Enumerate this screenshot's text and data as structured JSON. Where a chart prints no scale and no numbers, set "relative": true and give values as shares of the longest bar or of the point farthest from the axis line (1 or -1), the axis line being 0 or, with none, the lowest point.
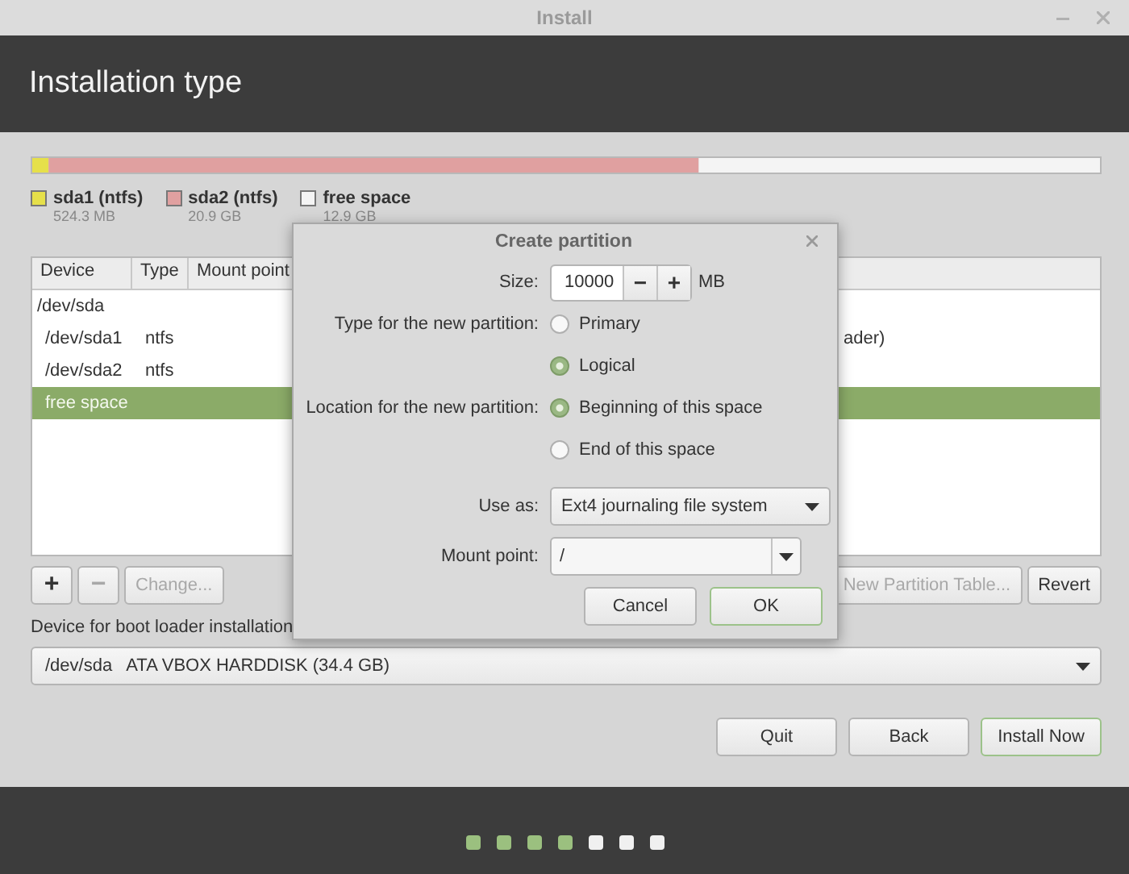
{
  "window": {
    "title": "Install"
  },
  "header": {
    "title": "Installation type"
  },
  "partition_bar": {
    "chart_data": {
      "type": "bar",
      "orientation": "horizontal",
      "stacked": true,
      "relative": true,
      "legend": "below",
      "value_labels": [
        "524.3 MB",
        "20.9 GB",
        "12.9 GB"
      ],
      "series": [
        {
          "name": "sda1 (ntfs)",
          "color": "#e6e04a",
          "values": [
            0.0153
          ]
        },
        {
          "name": "sda2 (ntfs)",
          "color": "#e0a0a0",
          "values": [
            0.6089
          ]
        },
        {
          "name": "free space",
          "color": "#f4f4f4",
          "values": [
            0.3758
          ]
        }
      ]
    }
  },
  "table": {
    "columns": [
      "Device",
      "Type",
      "Mount point"
    ],
    "rows": [
      {
        "device": "/dev/sda",
        "selected": false,
        "children": [
          {
            "device": "/dev/sda1",
            "type": "ntfs",
            "column_4": "ader)",
            "selected": false
          },
          {
            "device": "/dev/sda2",
            "type": "ntfs",
            "selected": false
          },
          {
            "device": "free space",
            "selected": true
          }
        ]
      }
    ]
  },
  "table_buttons": [
    {
      "label": "+",
      "disabled": false
    },
    {
      "label": "−",
      "disabled": true
    },
    {
      "label": "Change...",
      "disabled": true
    }
  ],
  "right_buttons": [
    {
      "label": "New Partition Table...",
      "disabled": true
    },
    {
      "label": "Revert",
      "disabled": false
    }
  ],
  "boot_loader": {
    "label": "Device for boot loader installation",
    "device": "/dev/sda",
    "description": "ATA VBOX HARDDISK (34.4 GB)"
  },
  "buttons": [
    {
      "label": "Quit",
      "default": false
    },
    {
      "label": "Back",
      "default": false
    },
    {
      "label": "Install Now",
      "default": true
    }
  ],
  "steps": [
    {
      "done": true
    },
    {
      "done": true
    },
    {
      "done": true
    },
    {
      "done": true
    },
    {
      "done": false
    },
    {
      "done": false
    },
    {
      "done": false
    }
  ],
  "dialog": {
    "title": "Create partition",
    "size": {
      "label": "Size:",
      "value": "10000",
      "minus": "−",
      "plus": "+",
      "unit": "MB"
    },
    "type": {
      "label": "Type for the new partition:",
      "options": [
        {
          "label": "Primary",
          "selected": false
        },
        {
          "label": "Logical",
          "selected": true
        }
      ]
    },
    "location": {
      "label": "Location for the new partition:",
      "options": [
        {
          "label": "Beginning of this space",
          "selected": true
        },
        {
          "label": "End of this space",
          "selected": false
        }
      ]
    },
    "use_as": {
      "label": "Use as:",
      "value": "Ext4 journaling file system"
    },
    "mount_point": {
      "label": "Mount point:",
      "value": "/"
    },
    "buttons": [
      {
        "label": "Cancel",
        "default": false
      },
      {
        "label": "OK",
        "default": true
      }
    ]
  }
}
